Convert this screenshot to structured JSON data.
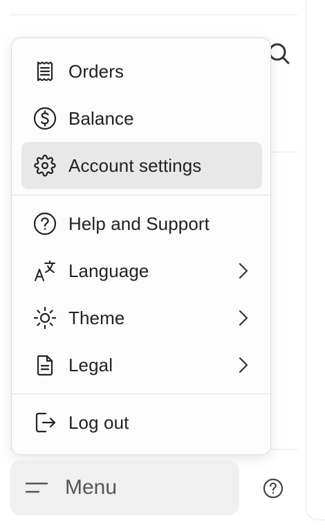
{
  "menu": {
    "items": [
      {
        "label": "Orders",
        "icon": "receipt-icon"
      },
      {
        "label": "Balance",
        "icon": "dollar-circle-icon"
      },
      {
        "label": "Account settings",
        "icon": "gear-icon",
        "active": true
      },
      {
        "label": "Help and Support",
        "icon": "help-circle-icon"
      },
      {
        "label": "Language",
        "icon": "language-icon",
        "submenu": true
      },
      {
        "label": "Theme",
        "icon": "sun-icon",
        "submenu": true
      },
      {
        "label": "Legal",
        "icon": "document-icon",
        "submenu": true
      },
      {
        "label": "Log out",
        "icon": "logout-icon"
      }
    ]
  },
  "footer": {
    "menu_label": "Menu"
  },
  "colors": {
    "popover_bg": "#fcfcfc",
    "active_item_bg": "#e8e8e8",
    "menu_button_bg": "#f0f0f0",
    "text": "#222222"
  }
}
